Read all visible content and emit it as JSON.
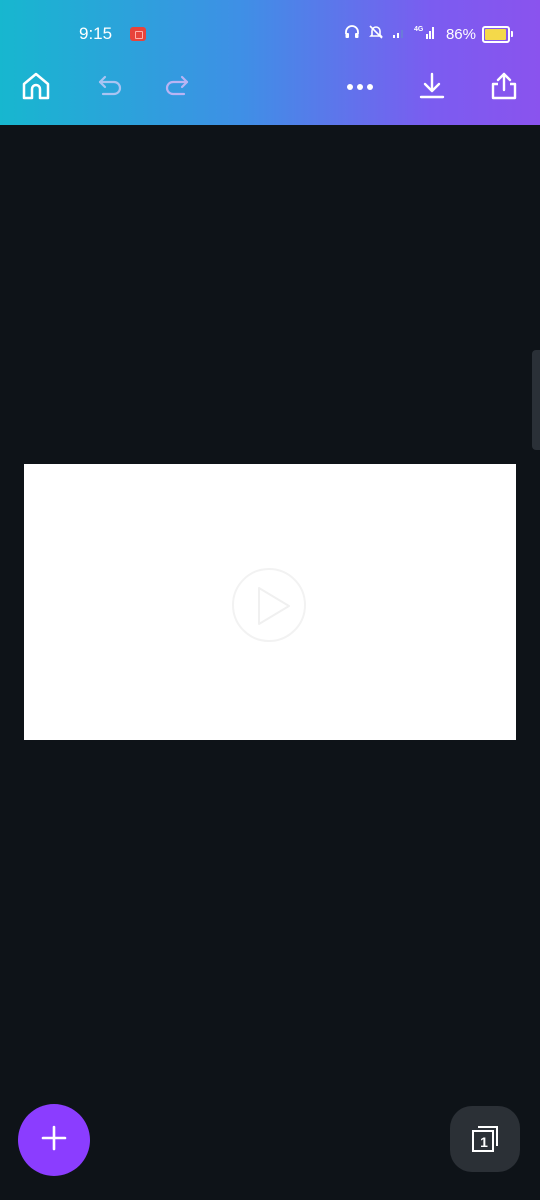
{
  "status_bar": {
    "time": "9:15",
    "battery_percent": "86%",
    "battery_level": 0.86,
    "icons": [
      "screen-record-icon",
      "headphones-icon",
      "bell-off-icon",
      "signal-icon",
      "4g-signal-icon",
      "battery-icon"
    ]
  },
  "toolbar": {
    "home_icon": "home-icon",
    "undo_icon": "undo-icon",
    "redo_icon": "redo-icon",
    "more_icon": "more-icon",
    "download_icon": "download-icon",
    "share_icon": "share-icon",
    "gradient_start": "#17b7cf",
    "gradient_end": "#8a53ee"
  },
  "canvas": {
    "background": "#0e1318",
    "page_background": "#ffffff",
    "media_icon": "play-icon"
  },
  "bottom": {
    "add_icon": "plus-icon",
    "add_color": "#8b3dff",
    "page_count": "1"
  }
}
